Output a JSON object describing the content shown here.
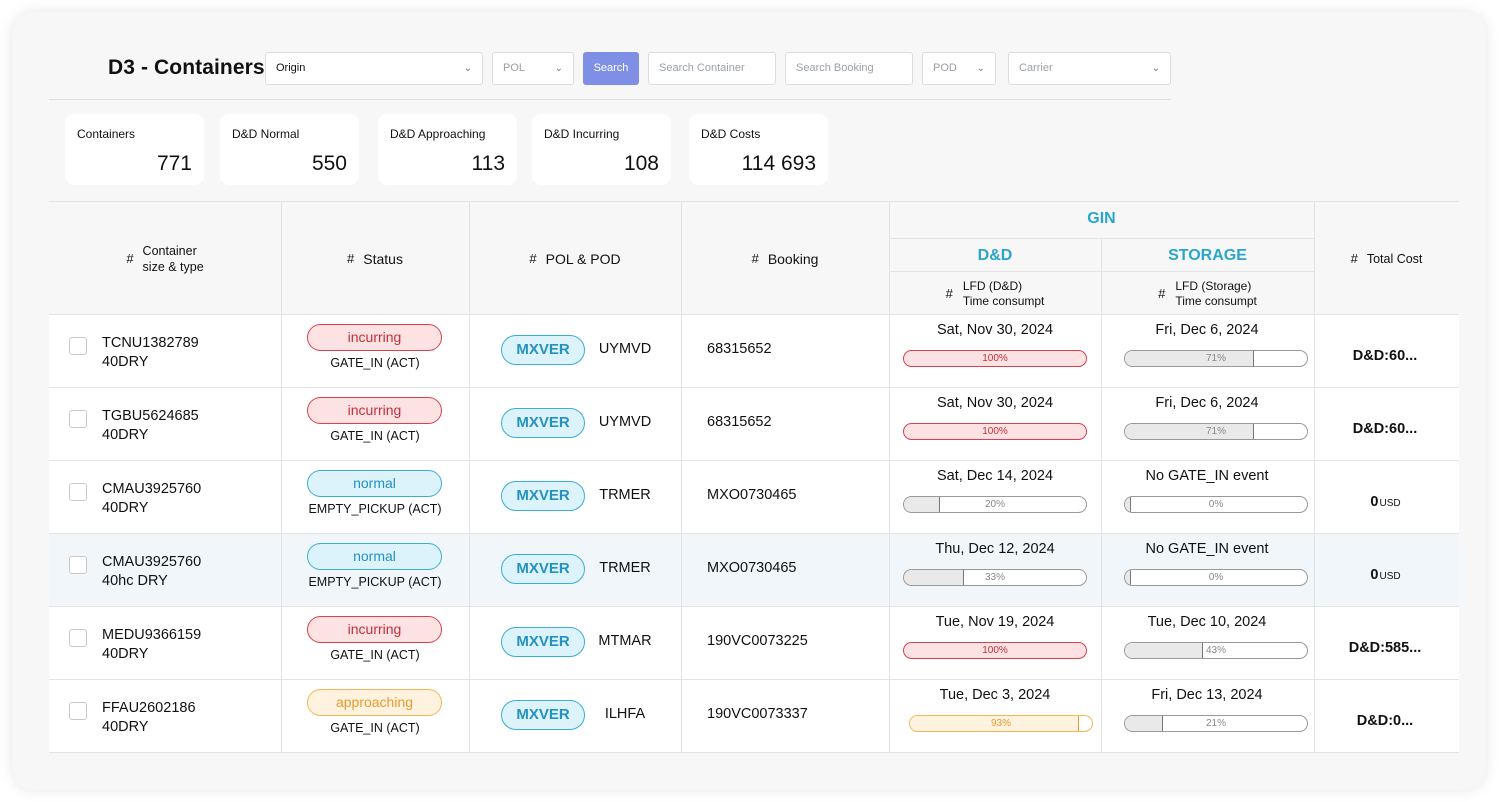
{
  "header": {
    "title": "D3 - Containers",
    "origin": "Origin",
    "pol_placeholder": "POL",
    "search_label": "Search",
    "search_container_placeholder": "Search Container",
    "search_booking_placeholder": "Search Booking",
    "pod_placeholder": "POD",
    "carrier_placeholder": "Carrier",
    "accent": "#7f8fe6"
  },
  "stats": [
    {
      "label": "Containers",
      "value": "771"
    },
    {
      "label": "D&D Normal",
      "value": "550"
    },
    {
      "label": "D&D Approaching",
      "value": "113"
    },
    {
      "label": "D&D Incurring",
      "value": "108"
    },
    {
      "label": "D&D Costs",
      "value": "114 693"
    }
  ],
  "columns": {
    "hash": "#",
    "container_line1": "Container",
    "container_line2": "size & type",
    "status": "Status",
    "pol_pod": "POL & POD",
    "booking": "Booking",
    "gin": "GIN",
    "dd": "D&D",
    "storage": "STORAGE",
    "lfd_dd_line1": "LFD (D&D)",
    "lfd_dd_line2": "Time consumpt",
    "lfd_storage_line1": "LFD (Storage)",
    "lfd_storage_line2": "Time consumpt",
    "total_cost": "Total Cost"
  },
  "rows": [
    {
      "container": "TCNU1382789",
      "type": "40DRY",
      "status": "incurring",
      "event": "GATE_IN (ACT)",
      "pol": "MXVER",
      "pod": "UYMVD",
      "booking": "68315652",
      "dd_date": "Sat, Nov 30, 2024",
      "dd_pct": "100%",
      "dd_val": 100,
      "dd_style": "red",
      "st_date": "Fri, Dec 6, 2024",
      "st_pct": "71%",
      "st_val": 71,
      "st_style": "grey",
      "cost": "D&D:60...",
      "cost_unit": ""
    },
    {
      "container": "TGBU5624685",
      "type": "40DRY",
      "status": "incurring",
      "event": "GATE_IN (ACT)",
      "pol": "MXVER",
      "pod": "UYMVD",
      "booking": "68315652",
      "dd_date": "Sat, Nov 30, 2024",
      "dd_pct": "100%",
      "dd_val": 100,
      "dd_style": "red",
      "st_date": "Fri, Dec 6, 2024",
      "st_pct": "71%",
      "st_val": 71,
      "st_style": "grey",
      "cost": "D&D:60...",
      "cost_unit": ""
    },
    {
      "container": "CMAU3925760",
      "type": "40DRY",
      "status": "normal",
      "event": "EMPTY_PICKUP (ACT)",
      "pol": "MXVER",
      "pod": "TRMER",
      "booking": "MXO0730465",
      "dd_date": "Sat, Dec 14, 2024",
      "dd_pct": "20%",
      "dd_val": 20,
      "dd_style": "grey",
      "st_date": "No GATE_IN event",
      "st_pct": "0%",
      "st_val": 0,
      "st_style": "grey",
      "cost": "0",
      "cost_unit": "USD"
    },
    {
      "container": "CMAU3925760",
      "type": "40hc DRY",
      "status": "normal",
      "event": "EMPTY_PICKUP (ACT)",
      "pol": "MXVER",
      "pod": "TRMER",
      "booking": "MXO0730465",
      "dd_date": "Thu, Dec 12, 2024",
      "dd_pct": "33%",
      "dd_val": 33,
      "dd_style": "grey",
      "st_date": "No GATE_IN event",
      "st_pct": "0%",
      "st_val": 0,
      "st_style": "grey",
      "cost": "0",
      "cost_unit": "USD"
    },
    {
      "container": "MEDU9366159",
      "type": "40DRY",
      "status": "incurring",
      "event": "GATE_IN (ACT)",
      "pol": "MXVER",
      "pod": "MTMAR",
      "booking": "190VC0073225",
      "dd_date": "Tue, Nov 19, 2024",
      "dd_pct": "100%",
      "dd_val": 100,
      "dd_style": "red",
      "st_date": "Tue, Dec 10, 2024",
      "st_pct": "43%",
      "st_val": 43,
      "st_style": "grey",
      "cost": "D&D:585...",
      "cost_unit": ""
    },
    {
      "container": "FFAU2602186",
      "type": "40DRY",
      "status": "approaching",
      "event": "GATE_IN (ACT)",
      "pol": "MXVER",
      "pod": "ILHFA",
      "booking": "190VC0073337",
      "dd_date": "Tue, Dec 3, 2024",
      "dd_pct": "93%",
      "dd_val": 93,
      "dd_style": "orange",
      "st_date": "Fri, Dec 13, 2024",
      "st_pct": "21%",
      "st_val": 21,
      "st_style": "grey",
      "cost": "D&D:0...",
      "cost_unit": ""
    }
  ],
  "status_colors": {
    "incurring": "#d9414d",
    "normal": "#3aaed5",
    "approaching": "#f3b658"
  }
}
